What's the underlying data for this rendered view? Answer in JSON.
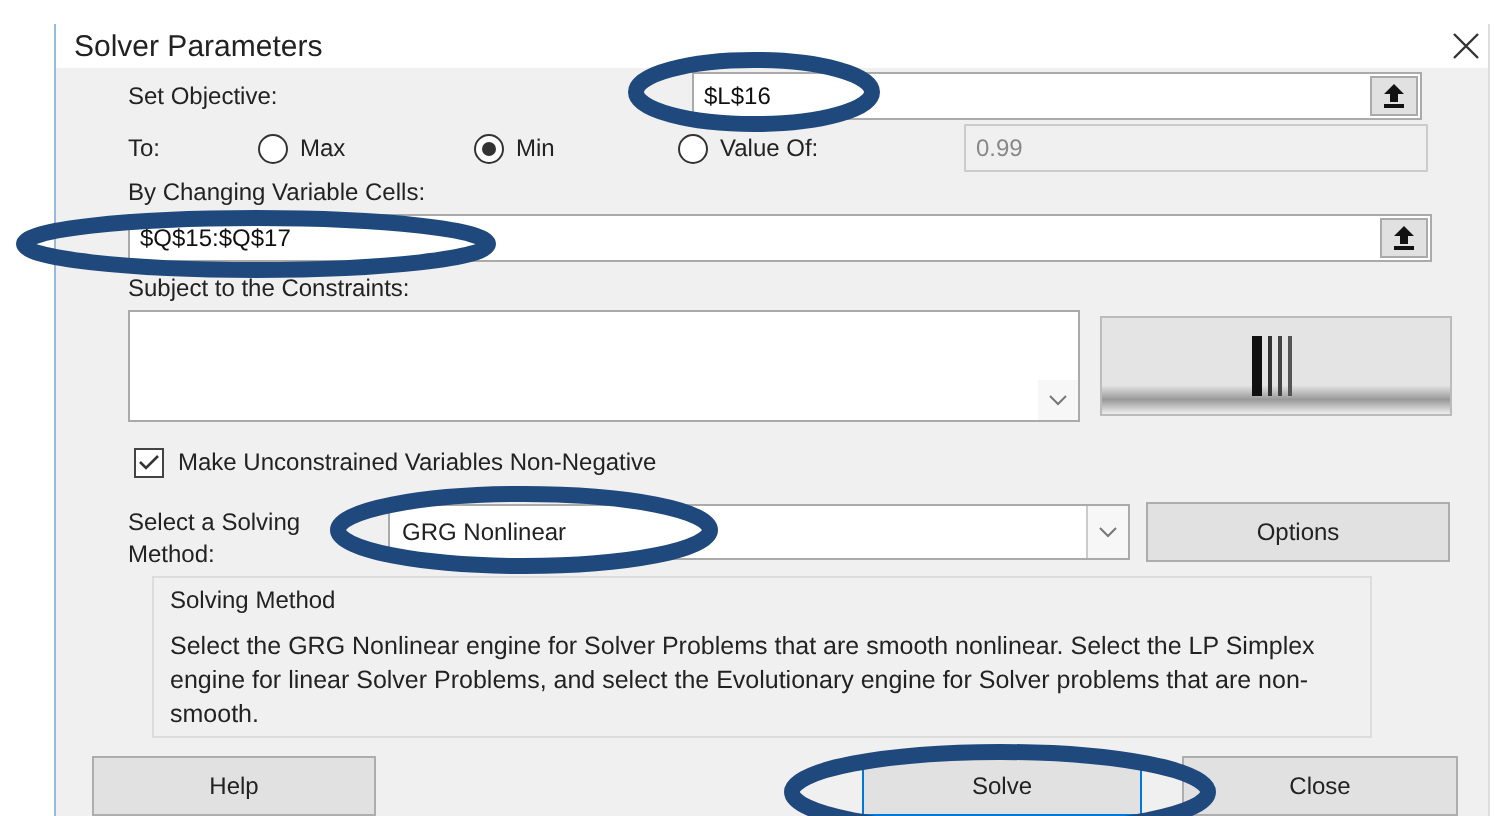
{
  "window": {
    "title": "Solver Parameters"
  },
  "objective": {
    "label": "Set Objective:",
    "value": "$L$16"
  },
  "to": {
    "label": "To:",
    "options": [
      {
        "label": "Max",
        "selected": false
      },
      {
        "label": "Min",
        "selected": true
      },
      {
        "label": "Value Of:",
        "selected": false
      }
    ],
    "value_of": {
      "value": "0.99",
      "disabled": true
    }
  },
  "changing": {
    "label": "By Changing Variable Cells:",
    "value": "$Q$15:$Q$17"
  },
  "constraints": {
    "label": "Subject to the Constraints:"
  },
  "non_negative": {
    "label": "Make Unconstrained Variables Non-Negative",
    "checked": true
  },
  "method": {
    "label": "Select a Solving Method:",
    "value": "GRG Nonlinear",
    "options_button": "Options"
  },
  "method_info": {
    "title": "Solving Method",
    "text": "Select the GRG Nonlinear engine for Solver Problems that are smooth nonlinear. Select the LP Simplex engine for linear Solver Problems, and select the Evolutionary engine for Solver problems that are non-smooth."
  },
  "buttons": [
    {
      "label": "Help",
      "focused": false
    },
    {
      "label": "Solve",
      "focused": true
    },
    {
      "label": "Close",
      "focused": false
    }
  ]
}
